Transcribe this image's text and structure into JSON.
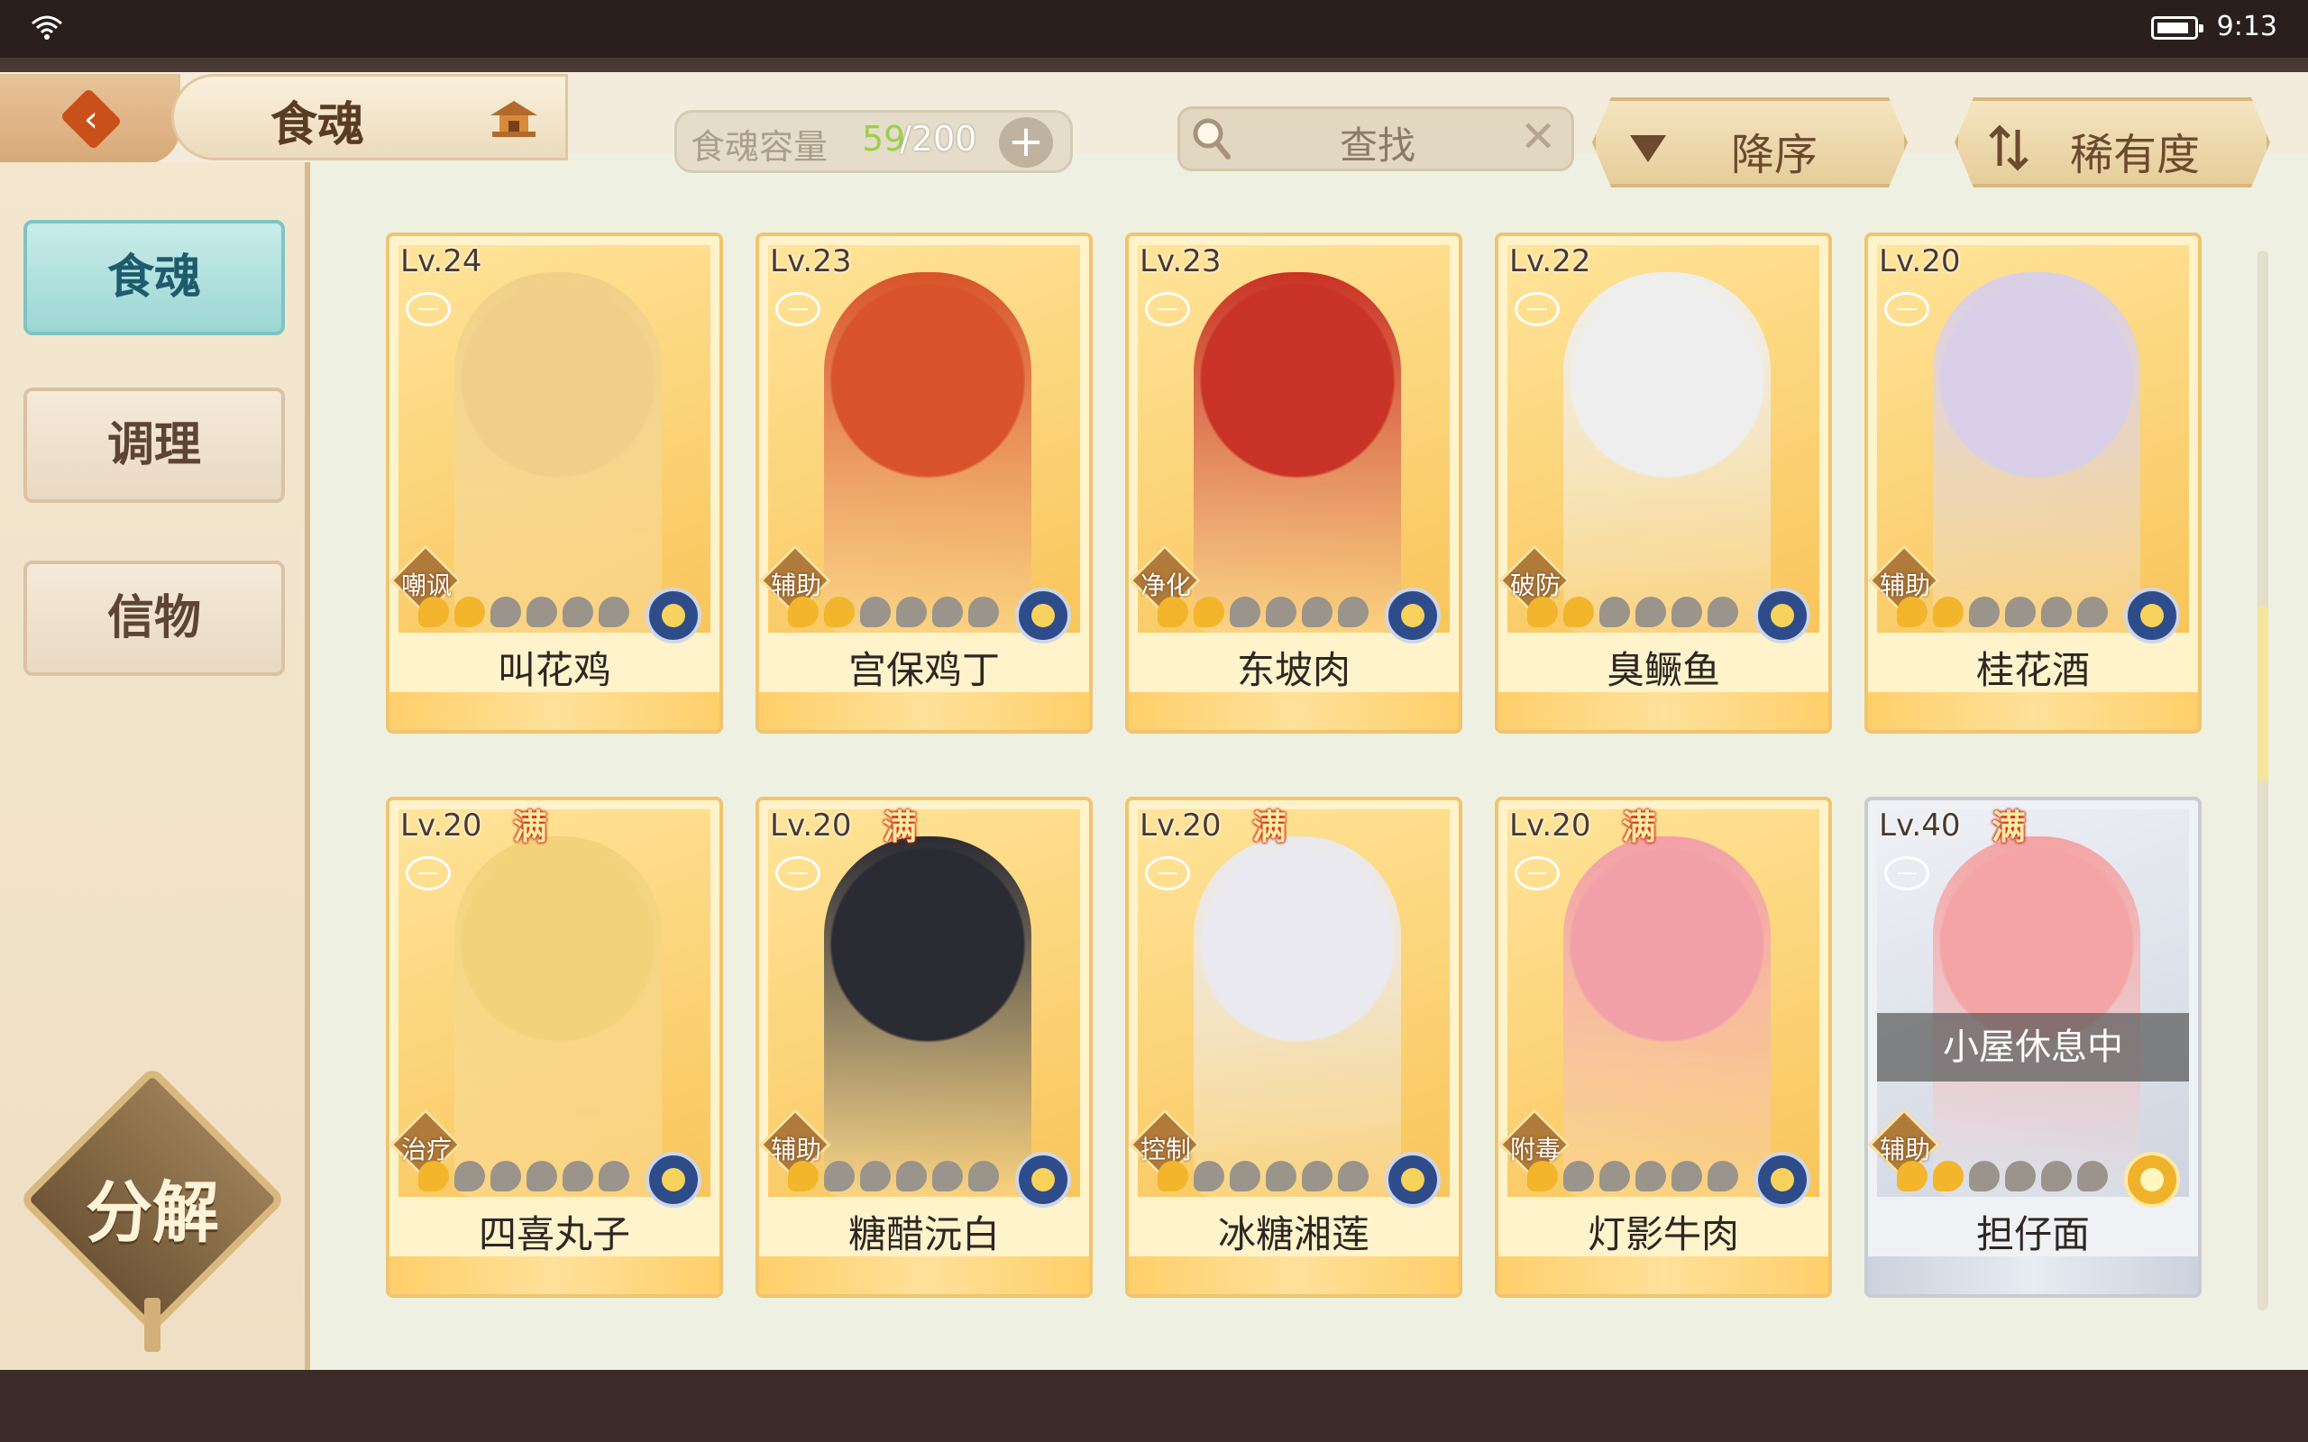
{
  "status_bar": {
    "time": "9:13"
  },
  "header": {
    "title": "食魂",
    "capacity_label": "食魂容量",
    "capacity_current": "59",
    "capacity_max": "/200",
    "search_placeholder": "查找",
    "sort_order_label": "降序",
    "sort_field_label": "稀有度"
  },
  "sidebar": {
    "items": [
      {
        "label": "食魂",
        "active": true
      },
      {
        "label": "调理",
        "active": false
      },
      {
        "label": "信物",
        "active": false
      }
    ],
    "decompose_label": "分解"
  },
  "cards": [
    {
      "level": "Lv.24",
      "name": "叫花鸡",
      "role": "嘲讽",
      "stars_on": 2,
      "stars_total": 6,
      "max": false,
      "emblem": "blue"
    },
    {
      "level": "Lv.23",
      "name": "宫保鸡丁",
      "role": "辅助",
      "stars_on": 2,
      "stars_total": 6,
      "max": false,
      "emblem": "blue"
    },
    {
      "level": "Lv.23",
      "name": "东坡肉",
      "role": "净化",
      "stars_on": 2,
      "stars_total": 6,
      "max": false,
      "emblem": "blue"
    },
    {
      "level": "Lv.22",
      "name": "臭鳜鱼",
      "role": "破防",
      "stars_on": 2,
      "stars_total": 6,
      "max": false,
      "emblem": "blue"
    },
    {
      "level": "Lv.20",
      "name": "桂花酒",
      "role": "辅助",
      "stars_on": 2,
      "stars_total": 6,
      "max": false,
      "emblem": "blue"
    },
    {
      "level": "Lv.20",
      "name": "四喜丸子",
      "role": "治疗",
      "stars_on": 1,
      "stars_total": 6,
      "max": true,
      "max_label": "满",
      "emblem": "blue"
    },
    {
      "level": "Lv.20",
      "name": "糖醋沅白",
      "role": "辅助",
      "stars_on": 1,
      "stars_total": 6,
      "max": true,
      "max_label": "满",
      "emblem": "blue"
    },
    {
      "level": "Lv.20",
      "name": "冰糖湘莲",
      "role": "控制",
      "stars_on": 1,
      "stars_total": 6,
      "max": true,
      "max_label": "满",
      "emblem": "blue"
    },
    {
      "level": "Lv.20",
      "name": "灯影牛肉",
      "role": "附毒",
      "stars_on": 1,
      "stars_total": 6,
      "max": true,
      "max_label": "满",
      "emblem": "blue"
    },
    {
      "level": "Lv.40",
      "name": "担仔面",
      "role": "辅助",
      "stars_on": 2,
      "stars_total": 6,
      "max": true,
      "max_label": "满",
      "emblem": "gold",
      "overlay": "小屋休息中",
      "frame": "silver"
    }
  ],
  "icons": {
    "back": "back-arrow-icon",
    "title": "pavilion-icon",
    "search": "search-icon",
    "clear": "close-icon",
    "sort_order": "triangle-down-icon",
    "sort_field": "swap-icon"
  },
  "colors": {
    "accent_teal": "#9cd6d4",
    "card_gold": "#f1c46e",
    "capacity_green": "#9ad04a"
  }
}
